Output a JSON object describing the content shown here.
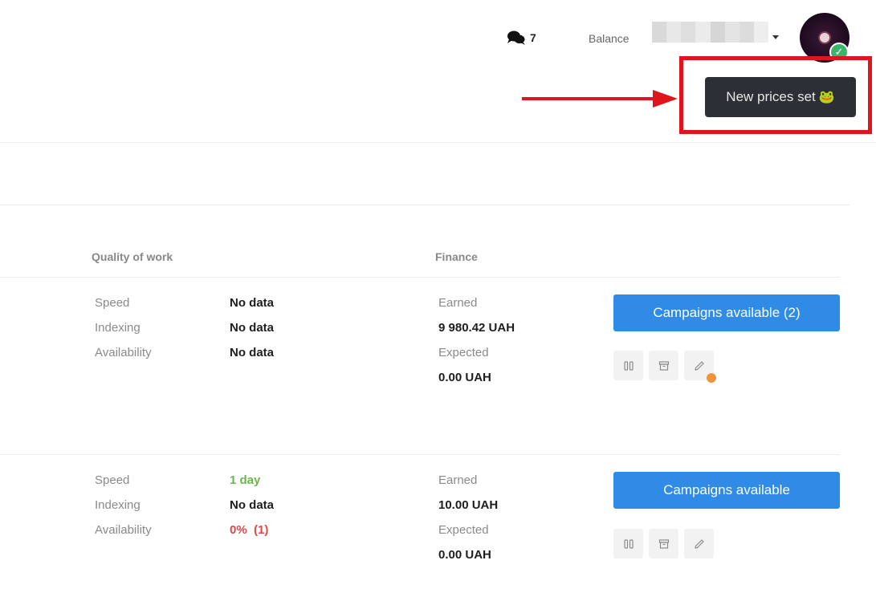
{
  "header": {
    "chat_count": "7",
    "balance_label": "Balance",
    "chat_icon": "chat-bubbles-icon",
    "dropdown_icon": "caret-down-icon",
    "avatar_badge_icon": "check-icon",
    "avatar_badge_text": "✓"
  },
  "annotation": {
    "tooltip_text": "New prices set",
    "tooltip_emoji": "🐸",
    "highlight_color": "#e0151b"
  },
  "columns": {
    "quality": "Quality of work",
    "finance": "Finance"
  },
  "rows": [
    {
      "speed_label": "Speed",
      "speed_value": "No data",
      "indexing_label": "Indexing",
      "indexing_value": "No data",
      "availability_label": "Availability",
      "availability_value": "No data",
      "earned_label": "Earned",
      "earned_value": "9 980.42 UAH",
      "expected_label": "Expected",
      "expected_value": "0.00 UAH",
      "campaigns_button": "Campaigns available (2)"
    },
    {
      "speed_label": "Speed",
      "speed_value": "1 day",
      "indexing_label": "Indexing",
      "indexing_value": "No data",
      "availability_label": "Availability",
      "availability_value": "0%  (1)",
      "earned_label": "Earned",
      "earned_value": "10.00 UAH",
      "expected_label": "Expected",
      "expected_value": "0.00 UAH",
      "campaigns_button": "Campaigns available"
    }
  ],
  "colors": {
    "primary": "#2f8be6",
    "good": "#67b84a",
    "bad": "#e04848",
    "notification": "#f0933b"
  }
}
